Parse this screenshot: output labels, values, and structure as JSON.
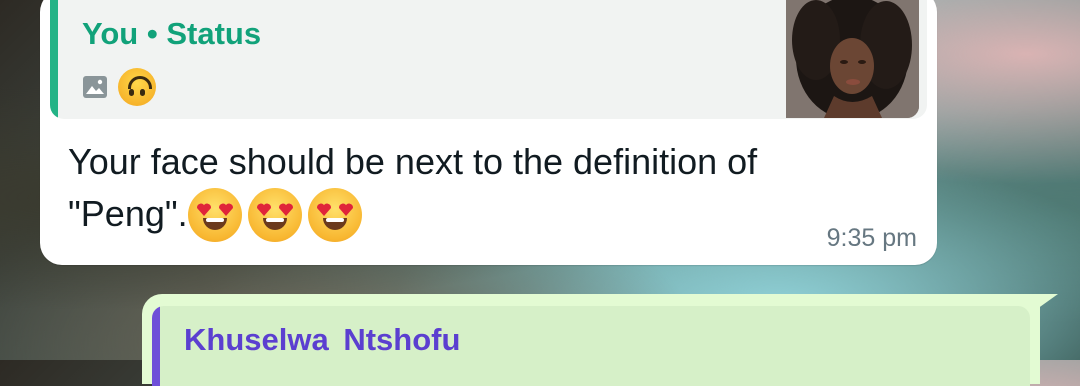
{
  "incoming_message": {
    "reply_quote": {
      "sender": "You • Status",
      "media_icon": "photo-icon",
      "emoji": "upside-down-face-emoji",
      "thumbnail": "status-photo-thumbnail"
    },
    "text": "Your face should be next to the definition of \"Peng\".",
    "emojis": [
      "heart-eyes-emoji",
      "heart-eyes-emoji",
      "heart-eyes-emoji"
    ],
    "time": "9:35 pm"
  },
  "outgoing_message": {
    "reply_quote": {
      "sender": "Khuselwa  Ntshofu"
    }
  },
  "colors": {
    "incoming_bubble": "#ffffff",
    "outgoing_bubble": "#e3fbd3",
    "status_quote_accent": "#24b386",
    "contact_quote_accent": "#6e4fd8"
  }
}
